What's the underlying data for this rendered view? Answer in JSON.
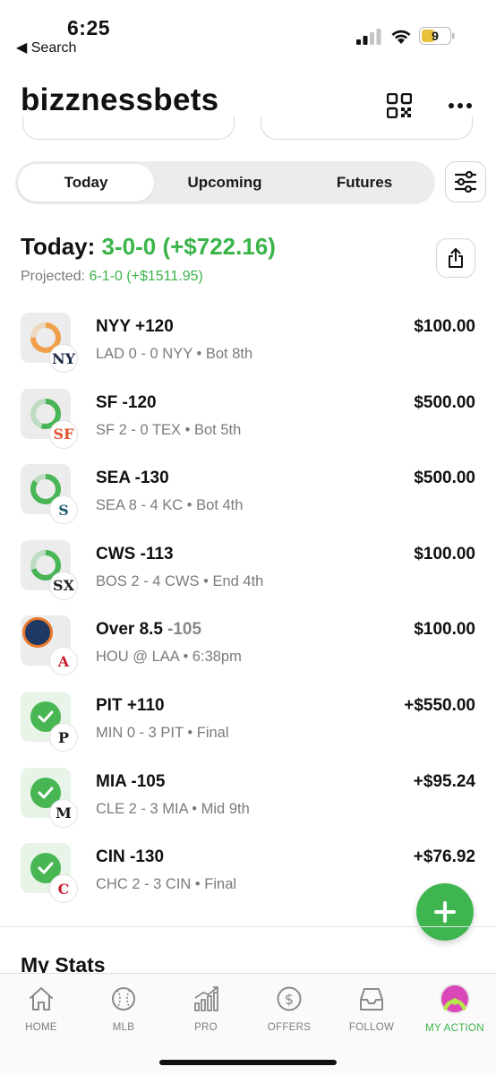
{
  "status_bar": {
    "time": "6:25",
    "back_label": "◀ Search",
    "battery": "9"
  },
  "header": {
    "title": "bizznessbets"
  },
  "tabs": [
    {
      "label": "Today",
      "active": true
    },
    {
      "label": "Upcoming",
      "active": false
    },
    {
      "label": "Futures",
      "active": false
    }
  ],
  "summary": {
    "label": "Today:",
    "record": "3-0-0 (+$722.16)",
    "projected_label": "Projected:",
    "projected_value": "6-1-0 (+$1511.95)"
  },
  "bets": [
    {
      "pick": "NYY +120",
      "pick_extra": "",
      "detail": "LAD 0 - 0 NYY • Bot 8th",
      "amount": "$100.00",
      "status": "live",
      "progress": 0.75,
      "ring_color": "#f0a04b",
      "team_logo": "NY",
      "logo_color": "#1c2a48"
    },
    {
      "pick": "SF -120",
      "pick_extra": "",
      "detail": "SF 2 - 0 TEX • Bot 5th",
      "amount": "$500.00",
      "status": "live",
      "progress": 0.55,
      "ring_color": "#48b556",
      "team_logo": "SF",
      "logo_color": "#e0542d"
    },
    {
      "pick": "SEA -130",
      "pick_extra": "",
      "detail": "SEA 8 - 4 KC • Bot 4th",
      "amount": "$500.00",
      "status": "live",
      "progress": 0.85,
      "ring_color": "#48b556",
      "team_logo": "S",
      "logo_color": "#1c5d6c"
    },
    {
      "pick": "CWS -113",
      "pick_extra": "",
      "detail": "BOS 2 - 4 CWS • End 4th",
      "amount": "$100.00",
      "status": "live",
      "progress": 0.7,
      "ring_color": "#48b556",
      "team_logo": "SX",
      "logo_color": "#222222"
    },
    {
      "pick": "Over 8.5",
      "pick_extra": "-105",
      "detail": "HOU @ LAA • 6:38pm",
      "amount": "$100.00",
      "status": "pending",
      "progress": 0,
      "ring_color": "#48b556",
      "team_logo": "A",
      "logo_color": "#c8202f"
    },
    {
      "pick": "PIT +110",
      "pick_extra": "",
      "detail": "MIN 0 - 3 PIT • Final",
      "amount": "+$550.00",
      "status": "won",
      "progress": 1,
      "ring_color": "#48b556",
      "team_logo": "P",
      "logo_color": "#1a1a1a"
    },
    {
      "pick": "MIA -105",
      "pick_extra": "",
      "detail": "CLE 2 - 3 MIA • Mid 9th",
      "amount": "+$95.24",
      "status": "won",
      "progress": 1,
      "ring_color": "#48b556",
      "team_logo": "M",
      "logo_color": "#1a1a1a"
    },
    {
      "pick": "CIN -130",
      "pick_extra": "",
      "detail": "CHC 2 - 3 CIN • Final",
      "amount": "+$76.92",
      "status": "won",
      "progress": 1,
      "ring_color": "#48b556",
      "team_logo": "C",
      "logo_color": "#c8202f"
    }
  ],
  "section": {
    "my_stats": "My Stats"
  },
  "tabbar": [
    {
      "label": "HOME",
      "icon": "home-icon",
      "active": false
    },
    {
      "label": "MLB",
      "icon": "baseball-icon",
      "active": false
    },
    {
      "label": "PRO",
      "icon": "chart-icon",
      "active": false
    },
    {
      "label": "OFFERS",
      "icon": "dollar-icon",
      "active": false
    },
    {
      "label": "FOLLOW",
      "icon": "inbox-icon",
      "active": false
    },
    {
      "label": "MY ACTION",
      "icon": "avatar-icon",
      "active": true
    }
  ],
  "colors": {
    "accent": "#3bb44a",
    "muted": "#7b7b7b"
  }
}
